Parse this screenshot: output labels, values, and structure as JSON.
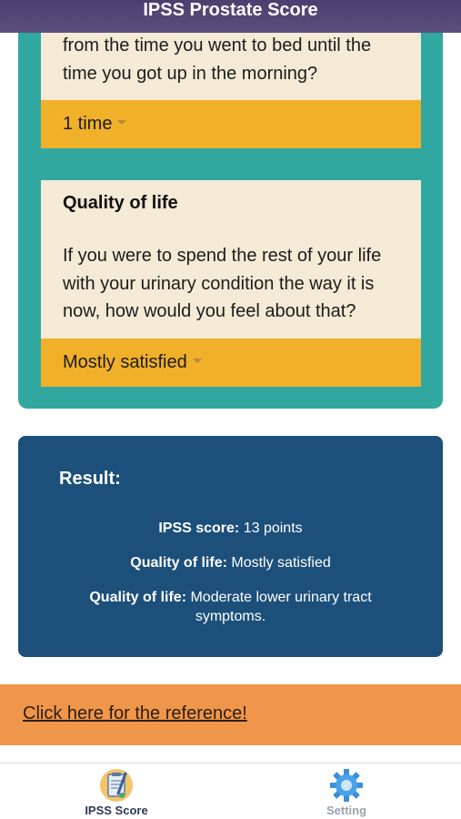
{
  "header": {
    "title": "IPSS Prostate Score"
  },
  "questions": [
    {
      "text": "from the time you went to bed until the time you got up in the morning?",
      "selected": "1 time"
    },
    {
      "title": "Quality of life",
      "text": "If you were to spend the rest of your life with your urinary condition the way it is now, how would you feel about that?",
      "selected": "Mostly satisfied"
    }
  ],
  "result": {
    "title": "Result:",
    "lines": [
      {
        "label": "IPSS score:",
        "value": " 13 points"
      },
      {
        "label": "Quality of life:",
        "value": " Mostly satisfied"
      },
      {
        "label": "Quality of life:",
        "value": " Moderate lower urinary tract symptoms."
      }
    ]
  },
  "reference": {
    "link_text": "Click here for the reference!"
  },
  "tabbar": {
    "tabs": [
      {
        "label": "IPSS Score",
        "icon": "clipboard-pen-icon",
        "active": true
      },
      {
        "label": "Setting",
        "icon": "gear-icon",
        "active": false
      }
    ]
  },
  "colors": {
    "header": "#4a3f6e",
    "teal_panel": "#31a89f",
    "card_bg": "#f4ead6",
    "select_bg": "#f1b02a",
    "result_bg": "#1c4f7a",
    "reference_bg": "#f0964a"
  }
}
